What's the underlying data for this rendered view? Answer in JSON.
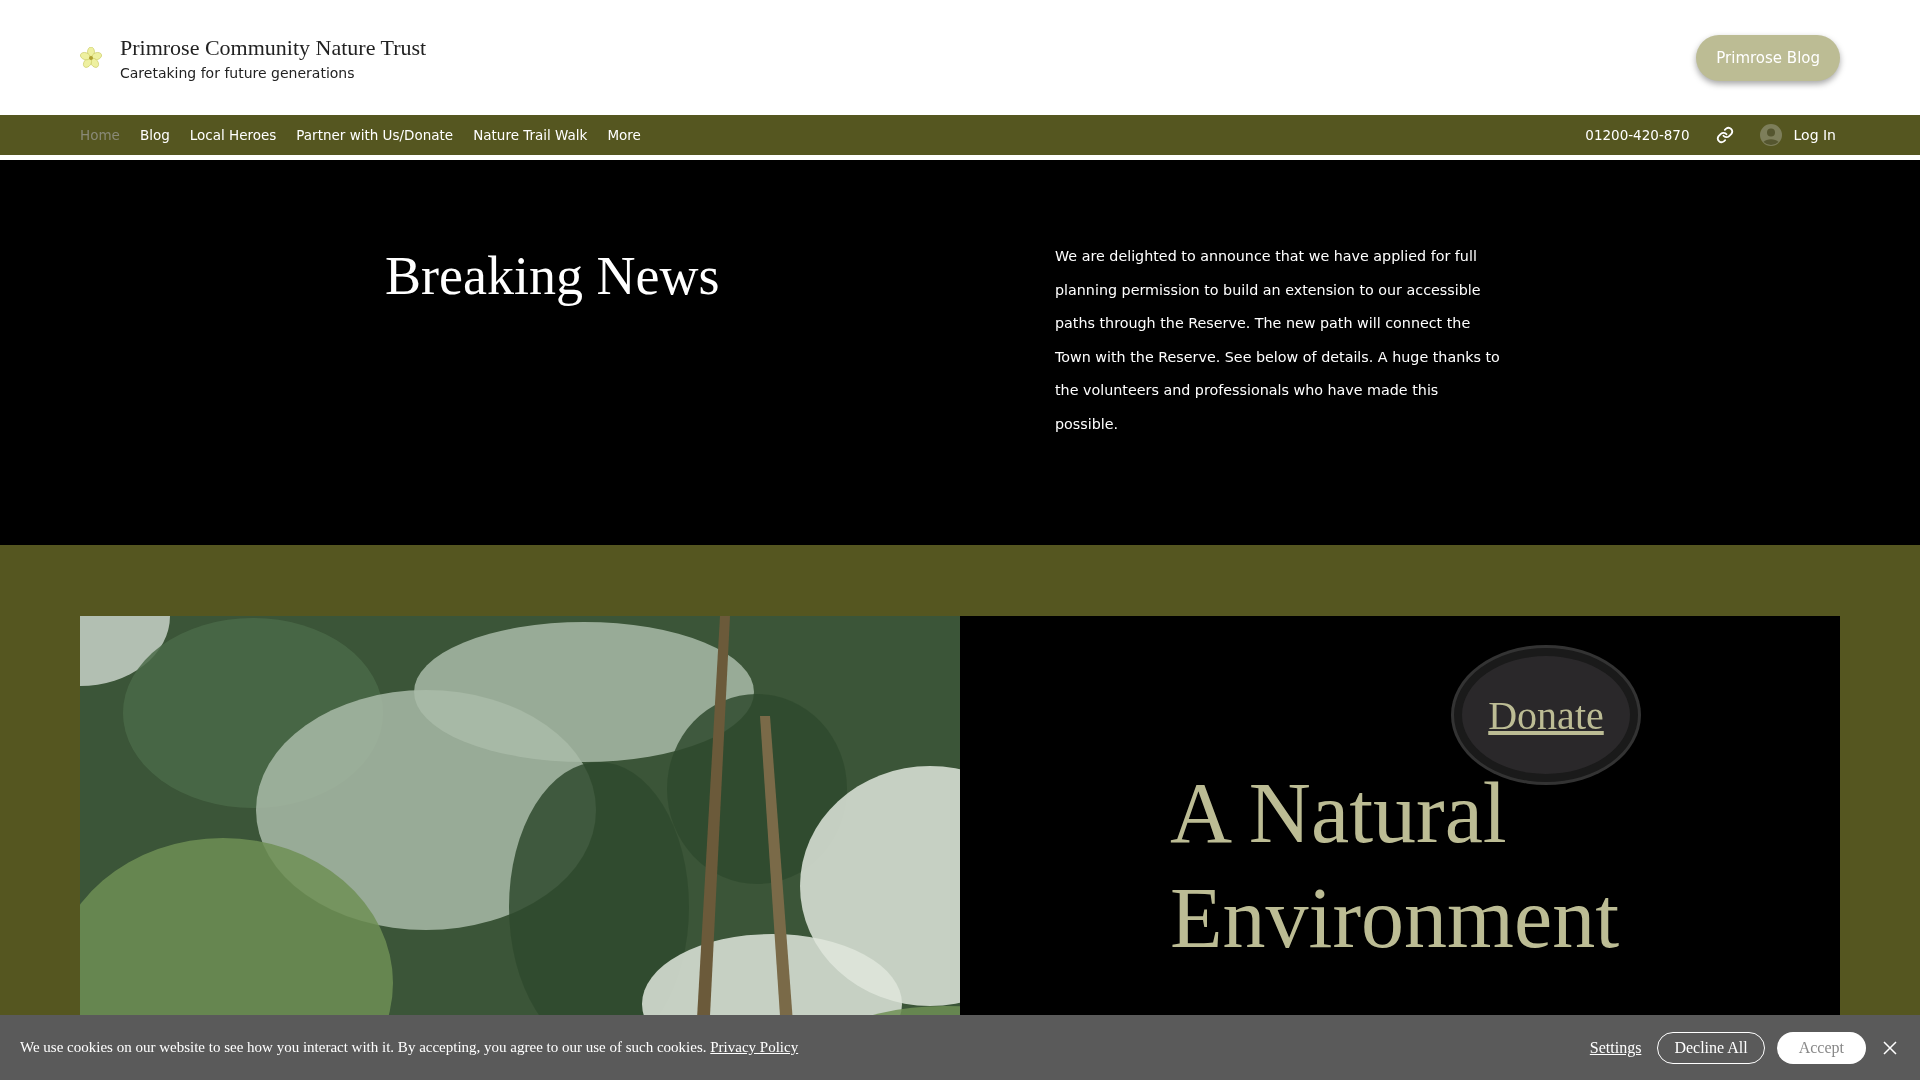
{
  "header": {
    "title": "Primrose Community Nature Trust",
    "tagline": "Caretaking for future generations",
    "cta": "Primrose Blog"
  },
  "nav": {
    "items": [
      {
        "label": "Home",
        "selected": true
      },
      {
        "label": "Blog",
        "selected": false
      },
      {
        "label": "Local Heroes",
        "selected": false
      },
      {
        "label": "Partner with Us/Donate",
        "selected": false
      },
      {
        "label": "Nature Trail Walk",
        "selected": false
      },
      {
        "label": "More",
        "selected": false
      }
    ],
    "phone": "01200-420-870",
    "login": "Log In"
  },
  "news": {
    "heading": "Breaking News",
    "body": "We are delighted to announce that we have applied for full planning permission to build an extension to our accessible paths through the Reserve. The new path will connect the Town with the Reserve. See below of details.  A huge thanks to the volunteers and professionals who have made this possible."
  },
  "feature": {
    "donate": "Donate",
    "heading": "A Natural Environment"
  },
  "cookie_bar": {
    "text": "We use cookies on our website to see how you interact with it. By accepting, you agree to our use of such cookies.",
    "policy_link": "Privacy Policy",
    "settings": "Settings",
    "decline": "Decline All",
    "accept": "Accept"
  }
}
